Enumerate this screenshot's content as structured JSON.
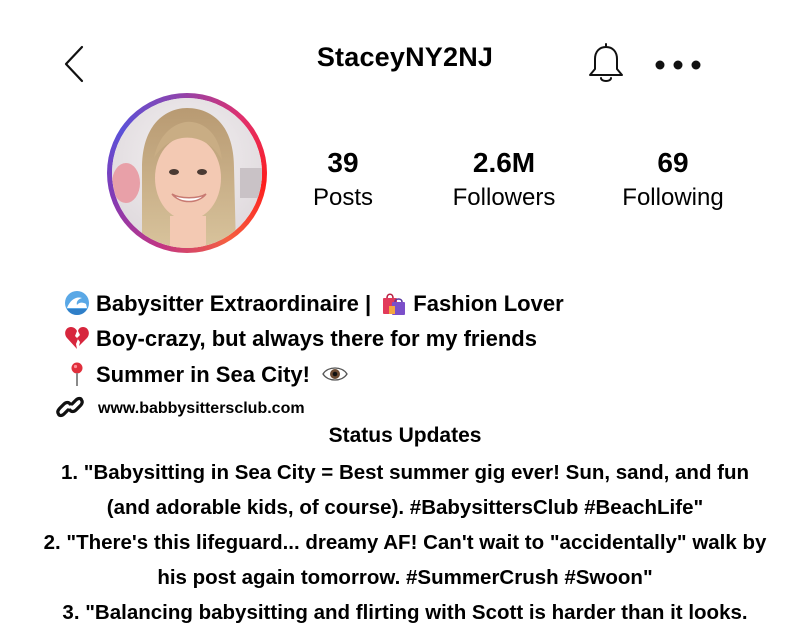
{
  "header": {
    "back_icon": "chevron-left-icon",
    "username": "StaceyNY2NJ",
    "bell_icon": "bell-icon",
    "more_icon": "ellipsis-icon"
  },
  "stats": [
    {
      "value": "39",
      "label": "Posts"
    },
    {
      "value": "2.6M",
      "label": "Followers"
    },
    {
      "value": "69",
      "label": "Following"
    }
  ],
  "bio": {
    "line1_part1": "Babysitter Extraordinaire |",
    "line1_part2": "Fashion Lover",
    "line2": "Boy-crazy, but always there for my friends",
    "line3": "Summer in Sea City!",
    "link": "www.babbysittersclub.com"
  },
  "status": {
    "title": "Status Updates",
    "lines": [
      "1. \"Babysitting in Sea City = Best summer gig ever! Sun, sand, and fun",
      "(and adorable kids, of course). #BabysittersClub #BeachLife\"",
      "2. \"There's this lifeguard... dreamy AF! Can't wait to \"accidentally\" walk by",
      "his post again tomorrow. #SummerCrush #Swoon\"",
      "3. \"Balancing babysitting and flirting with Scott is harder than it looks."
    ]
  },
  "colors": {
    "text": "#000000",
    "background": "#ffffff",
    "ring_pink": "#e1306c",
    "ring_purple": "#833ab4"
  }
}
